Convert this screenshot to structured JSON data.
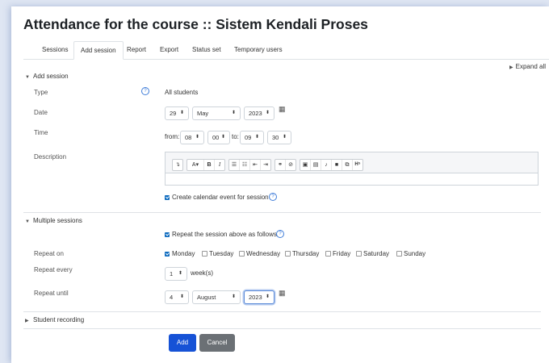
{
  "page": {
    "title": "Attendance for the course :: Sistem Kendali Proses"
  },
  "tabs": [
    {
      "label": "Sessions"
    },
    {
      "label": "Add session"
    },
    {
      "label": "Report"
    },
    {
      "label": "Export"
    },
    {
      "label": "Status set"
    },
    {
      "label": "Temporary users"
    }
  ],
  "expand_all": "Expand all",
  "add_section": {
    "header": "Add session",
    "type_label": "Type",
    "type_value": "All students",
    "date_label": "Date",
    "date": {
      "day": "29",
      "month": "May",
      "year": "2023"
    },
    "time_label": "Time",
    "time": {
      "from_label": "from:",
      "from_h": "08",
      "from_m": "00",
      "to_label": "to:",
      "to_h": "09",
      "to_m": "30"
    },
    "description_label": "Description",
    "calendar_event_label": "Create calendar event for session"
  },
  "multiple_section": {
    "header": "Multiple sessions",
    "repeat_label": "Repeat the session above as follows",
    "repeat_on_label": "Repeat on",
    "days": [
      {
        "label": "Monday",
        "checked": true
      },
      {
        "label": "Tuesday",
        "checked": false
      },
      {
        "label": "Wednesday",
        "checked": false
      },
      {
        "label": "Thursday",
        "checked": false
      },
      {
        "label": "Friday",
        "checked": false
      },
      {
        "label": "Saturday",
        "checked": false
      },
      {
        "label": "Sunday",
        "checked": false
      }
    ],
    "repeat_every_label": "Repeat every",
    "repeat_every_value": "1",
    "repeat_every_unit": "week(s)",
    "repeat_until_label": "Repeat until",
    "repeat_until": {
      "day": "4",
      "month": "August",
      "year": "2023"
    }
  },
  "student_recording": {
    "header": "Student recording"
  },
  "buttons": {
    "add": "Add",
    "cancel": "Cancel"
  },
  "colors": {
    "primary": "#0f6cbf",
    "add_button": "#1652d6",
    "cancel_button": "#6b7075"
  }
}
